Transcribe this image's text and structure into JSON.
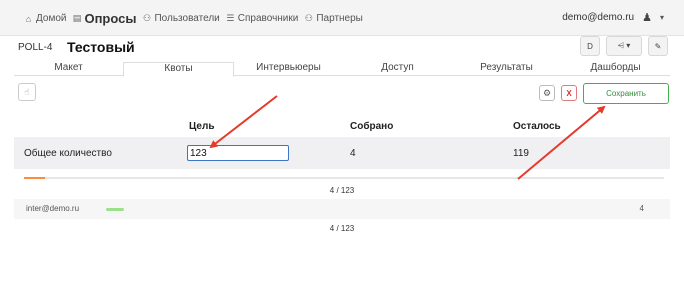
{
  "nav": {
    "items": [
      {
        "icon": "home-icon",
        "glyph": "⌂",
        "label": "Домой"
      },
      {
        "icon": "clipboard-icon",
        "glyph": "▤",
        "label": "Опросы",
        "brand": true
      },
      {
        "icon": "users-icon",
        "glyph": "⚇",
        "label": "Пользователи"
      },
      {
        "icon": "list-icon",
        "glyph": "☰",
        "label": "Справочники"
      },
      {
        "icon": "users-icon",
        "glyph": "⚇",
        "label": "Партнеры"
      }
    ],
    "user_email": "demo@demo.ru",
    "user_icon": "user-icon",
    "caret": "▾"
  },
  "header": {
    "poll_id": "POLL-4",
    "title": "Тестовый",
    "btn_d": "D",
    "btn_share": "⩤ ▾",
    "btn_edit": "✎"
  },
  "tabs": [
    {
      "label": "Макет",
      "active": false
    },
    {
      "label": "Квоты",
      "active": true
    },
    {
      "label": "Интервьюеры",
      "active": false
    },
    {
      "label": "Доступ",
      "active": false
    },
    {
      "label": "Результаты",
      "active": false
    },
    {
      "label": "Дашборды",
      "active": false
    }
  ],
  "toolbar": {
    "gear_glyph": "⚙",
    "close_label": "X",
    "save_label": "Сохранить"
  },
  "table": {
    "headers": {
      "goal": "Цель",
      "collected": "Собрано",
      "remaining": "Осталось"
    },
    "total_row": {
      "label": "Общее количество",
      "goal_value": "123",
      "collected": "4",
      "remaining": "119"
    },
    "progress_fraction": 0.0325,
    "total_count_text": "4 / 123",
    "user_row": {
      "email": "inter@demo.ru",
      "count": "4",
      "count_text": "4 / 123"
    }
  },
  "colors": {
    "accent_orange": "#ff8a3c",
    "save_green": "#42b14d",
    "close_red": "#d9302c",
    "input_blue": "#3b75c4",
    "annotation_red": "#e53a2c"
  }
}
